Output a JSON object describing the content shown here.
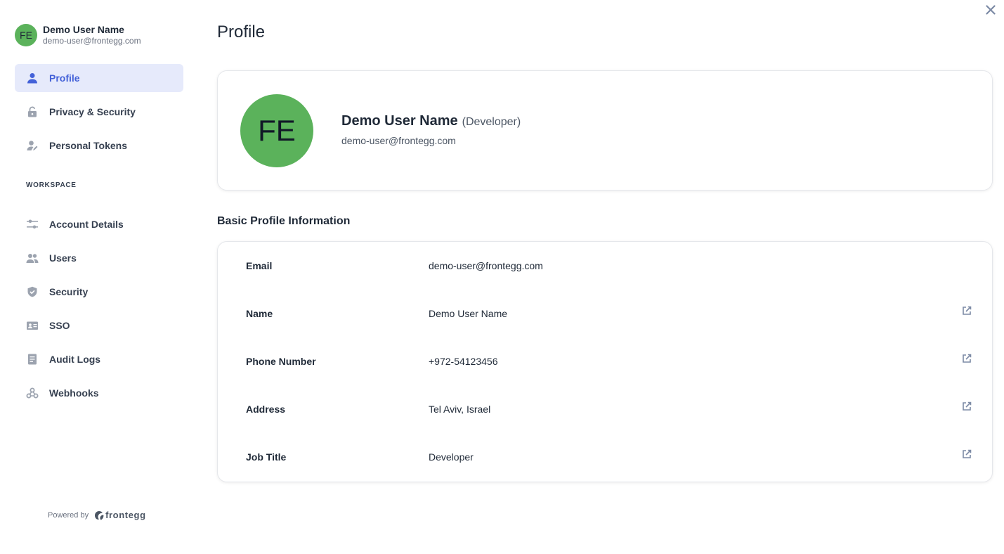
{
  "user": {
    "initials": "FE",
    "name": "Demo User Name",
    "email": "demo-user@frontegg.com",
    "role": "(Developer)"
  },
  "sidebar": {
    "items": [
      {
        "label": "Profile",
        "icon": "user-icon",
        "active": true
      },
      {
        "label": "Privacy & Security",
        "icon": "lock-icon"
      },
      {
        "label": "Personal Tokens",
        "icon": "token-icon"
      }
    ],
    "workspace_title": "WORKSPACE",
    "workspace_items": [
      {
        "label": "Account Details",
        "icon": "sliders-icon"
      },
      {
        "label": "Users",
        "icon": "users-icon"
      },
      {
        "label": "Security",
        "icon": "shield-icon"
      },
      {
        "label": "SSO",
        "icon": "sso-icon"
      },
      {
        "label": "Audit Logs",
        "icon": "document-icon"
      },
      {
        "label": "Webhooks",
        "icon": "webhook-icon"
      }
    ],
    "powered_by": "Powered by",
    "brand": "frontegg"
  },
  "main": {
    "title": "Profile",
    "basic_info_title": "Basic Profile Information",
    "fields": [
      {
        "label": "Email",
        "value": "demo-user@frontegg.com",
        "editable": false
      },
      {
        "label": "Name",
        "value": "Demo User Name",
        "editable": true
      },
      {
        "label": "Phone Number",
        "value": "+972-54123456",
        "editable": true
      },
      {
        "label": "Address",
        "value": "Tel Aviv, Israel",
        "editable": true
      },
      {
        "label": "Job Title",
        "value": "Developer",
        "editable": true
      }
    ]
  },
  "colors": {
    "accent": "#4361d8",
    "active_bg": "#e6eafb",
    "avatar": "#5bb25b"
  }
}
